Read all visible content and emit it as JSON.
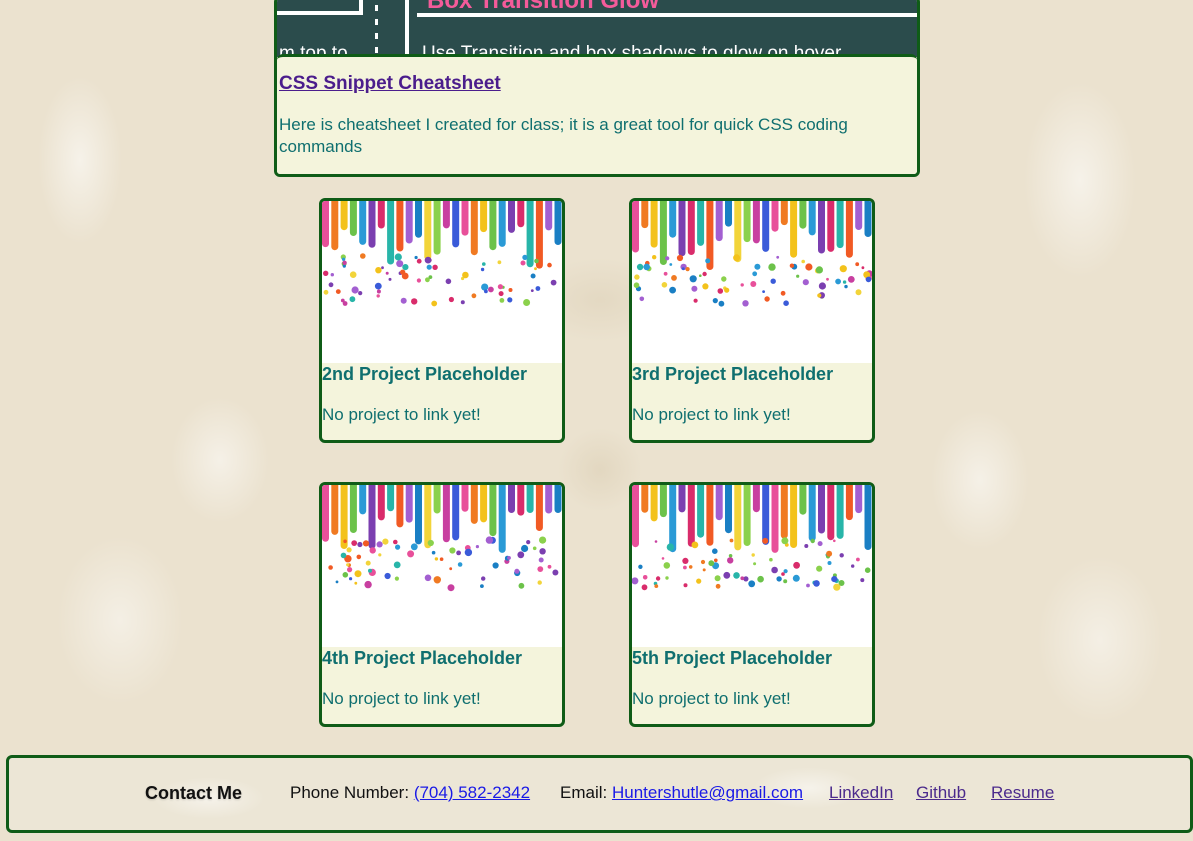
{
  "featured": {
    "banner": {
      "title": "Box Transition Glow",
      "subtitle": "Use Transition and box shadows to glow on hover",
      "left_text": "m top to"
    },
    "title": "CSS Snippet Cheatsheet",
    "description": "Here is cheatsheet I created for class; it is a great tool for quick CSS coding commands"
  },
  "projects": [
    {
      "title": "2nd Project Placeholder",
      "text": "No project to link yet!"
    },
    {
      "title": "3rd Project Placeholder",
      "text": "No project to link yet!"
    },
    {
      "title": "4th Project Placeholder",
      "text": "No project to link yet!"
    },
    {
      "title": "5th Project Placeholder",
      "text": "No project to link yet!"
    }
  ],
  "footer": {
    "heading": "Contact Me",
    "phone_label": "Phone Number:",
    "phone": "(704) 582-2342",
    "email_label": "Email:",
    "email": "Huntershutle@gmail.com",
    "linkedin": "LinkedIn",
    "github": "Github",
    "resume": "Resume"
  },
  "colors": {
    "border": "#0f5c17",
    "card_bg": "#f4f4dc",
    "teal_text": "#0f6f6f",
    "visited_link": "#4b2a8c",
    "link": "#1a1ae6"
  },
  "paint_colors": [
    "#e8509a",
    "#f07a22",
    "#f3c21b",
    "#6cc24a",
    "#2a9ad6",
    "#7b3fb0",
    "#d92c6b",
    "#28b5a9",
    "#f15a24",
    "#a35fd1",
    "#1a7fc4",
    "#f2d43a",
    "#8bd14c",
    "#c83fa0",
    "#3a5bd9"
  ]
}
